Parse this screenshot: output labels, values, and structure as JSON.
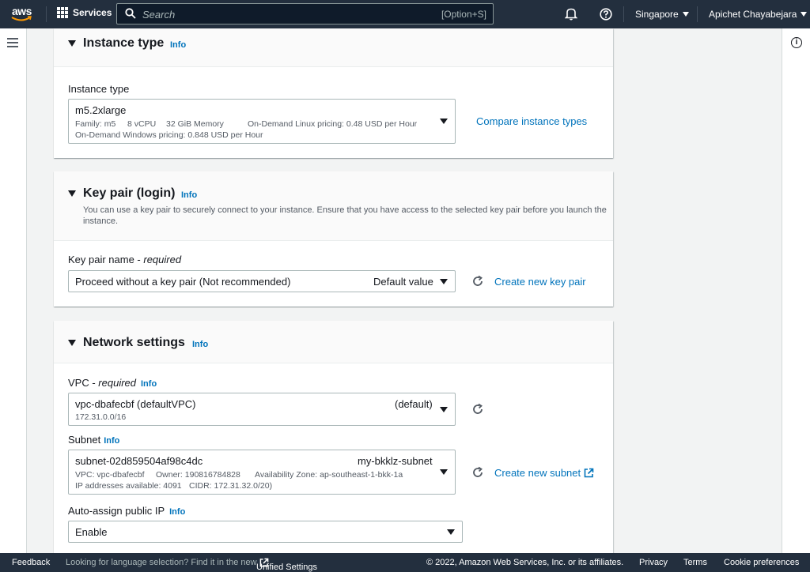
{
  "topnav": {
    "logo_text": "aws",
    "services_label": "Services",
    "search_placeholder": "Search",
    "search_shortcut": "[Option+S]",
    "region": "Singapore",
    "user": "Apichet Chayabejara"
  },
  "instance_type": {
    "title": "Instance type",
    "info": "Info",
    "field_label": "Instance type",
    "selected": "m5.2xlarge",
    "family": "Family: m5",
    "vcpu": "8 vCPU",
    "memory": "32 GiB Memory",
    "linux_pricing": "On-Demand Linux pricing: 0.48 USD per Hour",
    "windows_pricing": "On-Demand Windows pricing: 0.848 USD per Hour",
    "compare_link": "Compare instance types"
  },
  "key_pair": {
    "title": "Key pair (login)",
    "info": "Info",
    "description_line1": "You can use a key pair to securely connect to your instance. Ensure that you have access to the selected key pair before you launch the",
    "description_line2": "instance.",
    "field_label": "Key pair name - ",
    "field_required": "required",
    "selected": "Proceed without a key pair (Not recommended)",
    "default_value": "Default value",
    "create_link": "Create new key pair"
  },
  "network": {
    "title": "Network settings",
    "info": "Info",
    "vpc_label": "VPC - ",
    "vpc_required": "required",
    "vpc_info": "Info",
    "vpc_selected": "vpc-dbafecbf (defaultVPC)",
    "vpc_default": "(default)",
    "vpc_cidr": "172.31.0.0/16",
    "subnet_label": "Subnet",
    "subnet_info": "Info",
    "subnet_selected": "subnet-02d859504af98c4dc",
    "subnet_name": "my-bkklz-subnet",
    "subnet_vpc": "VPC: vpc-dbafecbf",
    "subnet_owner": "Owner: 190816784828",
    "subnet_az": "Availability Zone: ap-southeast-1-bkk-1a",
    "subnet_ips": "IP addresses available: 4091",
    "subnet_cidr": "CIDR: 172.31.32.0/20)",
    "create_subnet_link": "Create new subnet",
    "public_ip_label": "Auto-assign public IP",
    "public_ip_info": "Info",
    "public_ip_selected": "Enable"
  },
  "footer": {
    "feedback": "Feedback",
    "language_text": "Looking for language selection? Find it in the new",
    "unified_settings": "Unified Settings",
    "copyright": "© 2022, Amazon Web Services, Inc. or its affiliates.",
    "privacy": "Privacy",
    "terms": "Terms",
    "cookie": "Cookie preferences"
  }
}
